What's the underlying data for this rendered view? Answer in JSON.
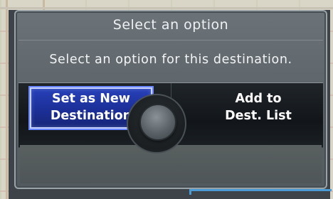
{
  "dialog": {
    "title": "Select an option",
    "message": "Select an option for this destination.",
    "options": [
      {
        "label": "Set as New\nDestination",
        "selected": true
      },
      {
        "label": "Add to\nDest. List",
        "selected": false
      }
    ]
  },
  "colors": {
    "selection_blue": "#1c2f98",
    "selection_border": "#c9d2ff",
    "dialog_gray": "#5c6469",
    "bar_dark": "#12161a"
  }
}
